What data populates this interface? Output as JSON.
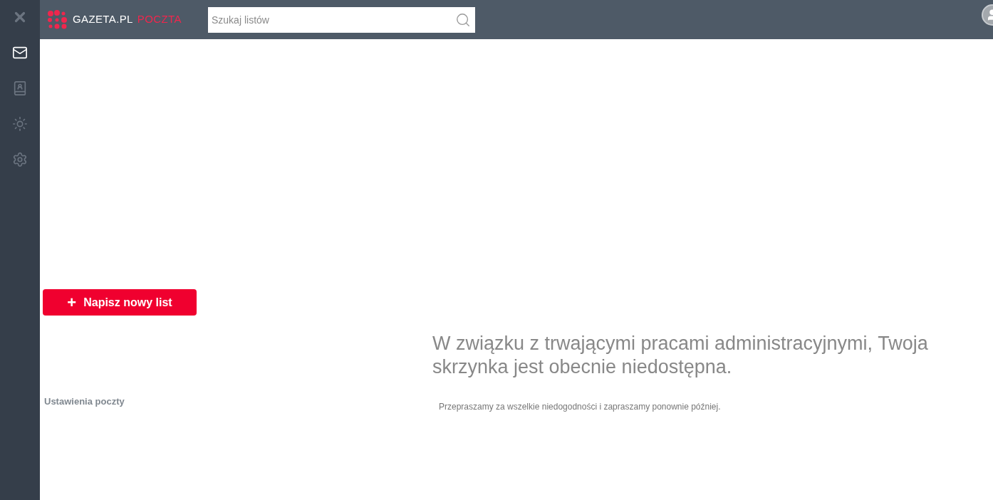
{
  "sidebar": {
    "items": [
      {
        "kind": "close",
        "selected": false
      },
      {
        "kind": "mail",
        "selected": true
      },
      {
        "kind": "contacts",
        "selected": false
      },
      {
        "kind": "theme",
        "selected": false
      },
      {
        "kind": "settings",
        "selected": false
      }
    ]
  },
  "header": {
    "logo": {
      "brand": "GAZETA.PL",
      "product": "POCZTA"
    },
    "search": {
      "placeholder": "Szukaj listów"
    }
  },
  "compose_button": {
    "icon": "+",
    "label": "Napisz nowy list"
  },
  "settings_link": "Ustawienia poczty",
  "message": {
    "heading": "W związku z trwającymi pracami administracyjnymi, Twoja skrzynka jest obecnie niedostępna.",
    "text": "Przepraszamy za wszelkie niedogodności i zapraszamy ponownie później."
  }
}
